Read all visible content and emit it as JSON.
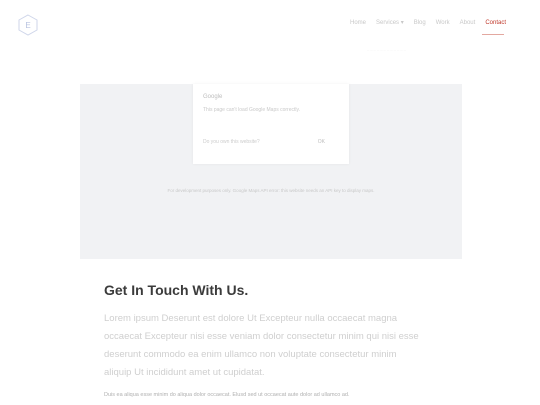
{
  "header": {
    "logo_letter": "E",
    "nav": [
      {
        "label": "Home",
        "active": false
      },
      {
        "label": "Services ▾",
        "active": false
      },
      {
        "label": "Blog",
        "active": false
      },
      {
        "label": "Work",
        "active": false
      },
      {
        "label": "About",
        "active": false
      },
      {
        "label": "Contact",
        "active": true
      }
    ],
    "subtext": "_ _ _ _ _ _ _ _ _ _ _ _"
  },
  "map": {
    "card_title": "Google",
    "card_text": "This page can't load Google Maps correctly.",
    "card_link": "Do you own this website?",
    "card_button": "OK",
    "error_text": "For development purposes only. Google Maps API error: this website needs an API key to display maps."
  },
  "content": {
    "heading": "Get In Touch With Us.",
    "lead": "Lorem ipsum Deserunt est dolore Ut Excepteur nulla occaecat magna occaecat Excepteur nisi esse veniam dolor consectetur minim qui nisi esse deserunt commodo ea enim ullamco non voluptate consectetur minim aliquip Ut incididunt amet ut cupidatat.",
    "small": "Duis ea aliqua esse minim do aliqua dolor occaecat. Elusd sed ut occaecat aute dolor ad ullamco ad."
  },
  "colors": {
    "accent": "#c0392b",
    "heading": "#3b3b3b",
    "map_bg": "#f1f2f4"
  }
}
